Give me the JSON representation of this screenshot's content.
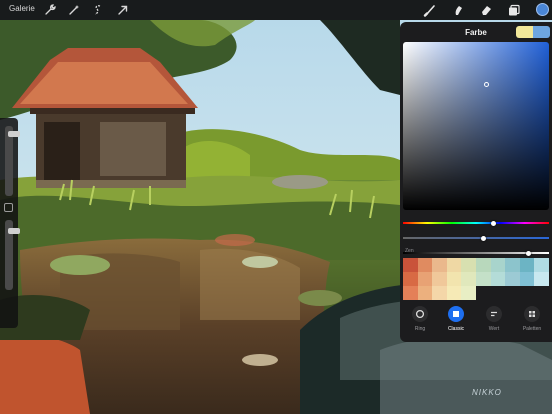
{
  "toolbar": {
    "gallery_label": "Galerie",
    "left_icons": [
      "wrench-icon",
      "magic-wand-icon",
      "selection-icon",
      "transform-arrow-icon"
    ],
    "right_icons": [
      "brush-icon",
      "smudge-icon",
      "eraser-icon",
      "layers-icon"
    ],
    "current_color": "#4a86d6"
  },
  "sidebar": {
    "brush_size_level": 0.92,
    "opacity_level": 0.88
  },
  "color_panel": {
    "title": "Farbe",
    "current_color": "#f2e89a",
    "previous_color": "#6ea6e0",
    "hue_level": 0.62,
    "saturation_level": 0.55,
    "brightness_level": 0.86,
    "palette_name": "Zen",
    "palette": [
      "#c9533a",
      "#e08b60",
      "#eab88c",
      "#efd8a4",
      "#d8e0b0",
      "#b8d8bc",
      "#a8d4cc",
      "#8cc4cc",
      "#6cb4c4",
      "#b0dce4",
      "#d86a44",
      "#e8a274",
      "#f0c89a",
      "#f2e4ae",
      "#e0e8bc",
      "#c4e0c8",
      "#b4dcd8",
      "#9ccad4",
      "#80c0d4",
      "#c8e8f0",
      "#e48058",
      "#ecb07e",
      "#f4d6a8",
      "#f6eab6",
      "#e8eec4",
      "#1c1c1e",
      "#1c1c1e",
      "#1c1c1e",
      "#1c1c1e",
      "#1c1c1e"
    ],
    "tabs": [
      {
        "label": "Ring",
        "icon": "ring-icon",
        "active": false
      },
      {
        "label": "Classic",
        "icon": "classic-icon",
        "active": true
      },
      {
        "label": "Wert",
        "icon": "value-icon",
        "active": false
      },
      {
        "label": "Paletten",
        "icon": "palettes-icon",
        "active": false
      }
    ]
  },
  "artwork": {
    "signature": "NIKKO"
  }
}
